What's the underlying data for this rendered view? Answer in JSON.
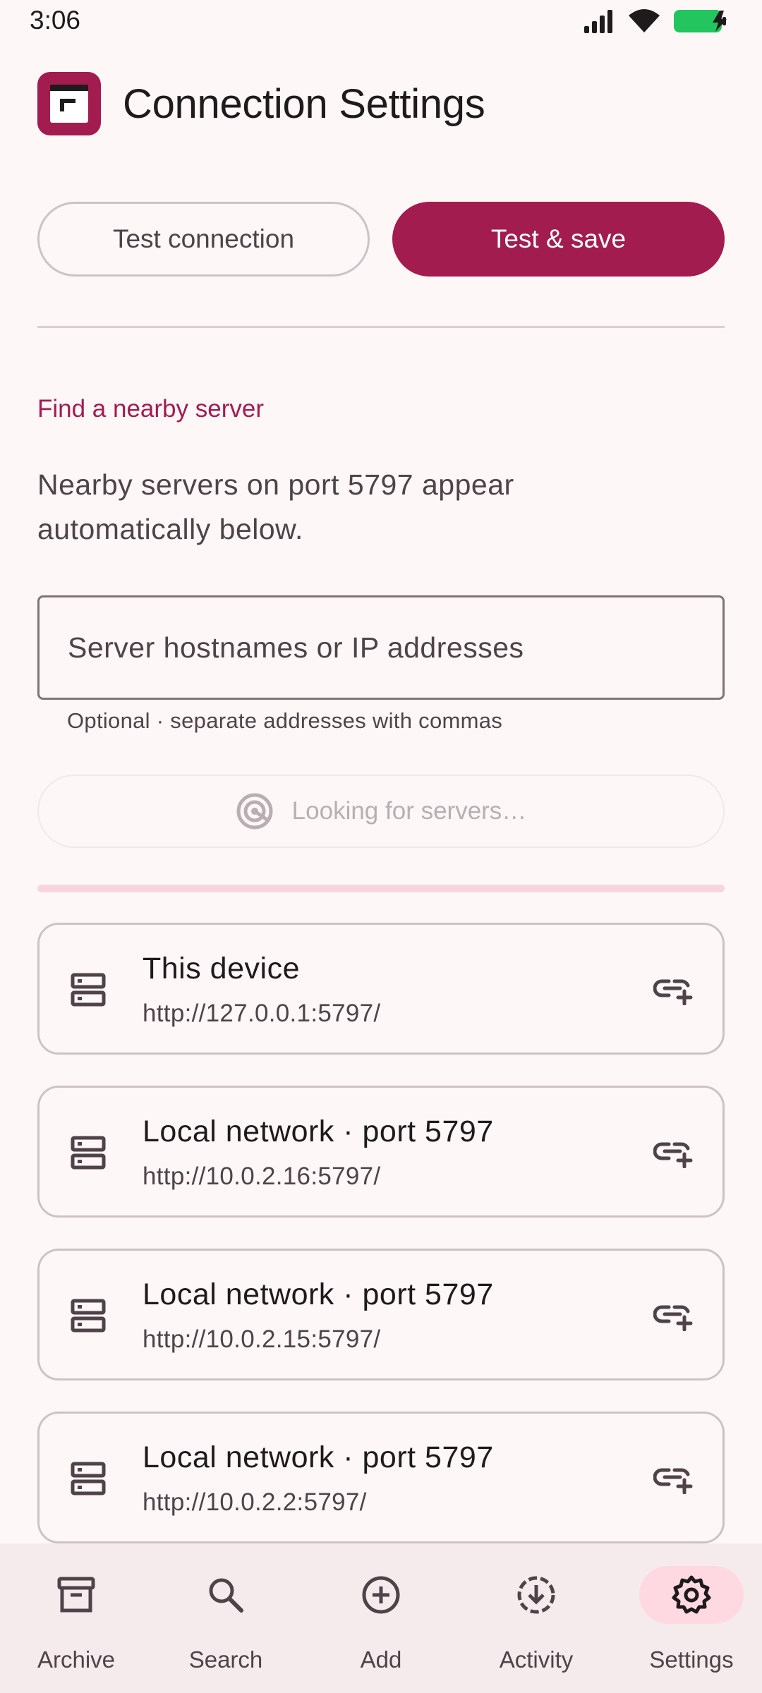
{
  "status_bar": {
    "time": "3:06"
  },
  "header": {
    "title": "Connection Settings"
  },
  "actions": {
    "test_label": "Test connection",
    "save_label": "Test & save"
  },
  "discovery": {
    "heading": "Find a nearby server",
    "description": "Nearby servers on port 5797 appear automatically below.",
    "input_placeholder": "Server hostnames or IP addresses",
    "input_value": "",
    "helper": "Optional · separate addresses with commas",
    "scan_label": "Looking for servers…"
  },
  "servers": [
    {
      "name": "This device",
      "url": "http://127.0.0.1:5797/"
    },
    {
      "name": "Local network · port 5797",
      "url": "http://10.0.2.16:5797/"
    },
    {
      "name": "Local network · port 5797",
      "url": "http://10.0.2.15:5797/"
    },
    {
      "name": "Local network · port 5797",
      "url": "http://10.0.2.2:5797/"
    }
  ],
  "nav": [
    {
      "label": "Archive",
      "icon": "archive-icon"
    },
    {
      "label": "Search",
      "icon": "search-icon"
    },
    {
      "label": "Add",
      "icon": "add-circle-icon"
    },
    {
      "label": "Activity",
      "icon": "download-activity-icon"
    },
    {
      "label": "Settings",
      "icon": "gear-icon",
      "active": true
    }
  ],
  "colors": {
    "accent": "#a31c4f",
    "background": "#fdf7f7",
    "nav_active": "#ffd9e2"
  }
}
